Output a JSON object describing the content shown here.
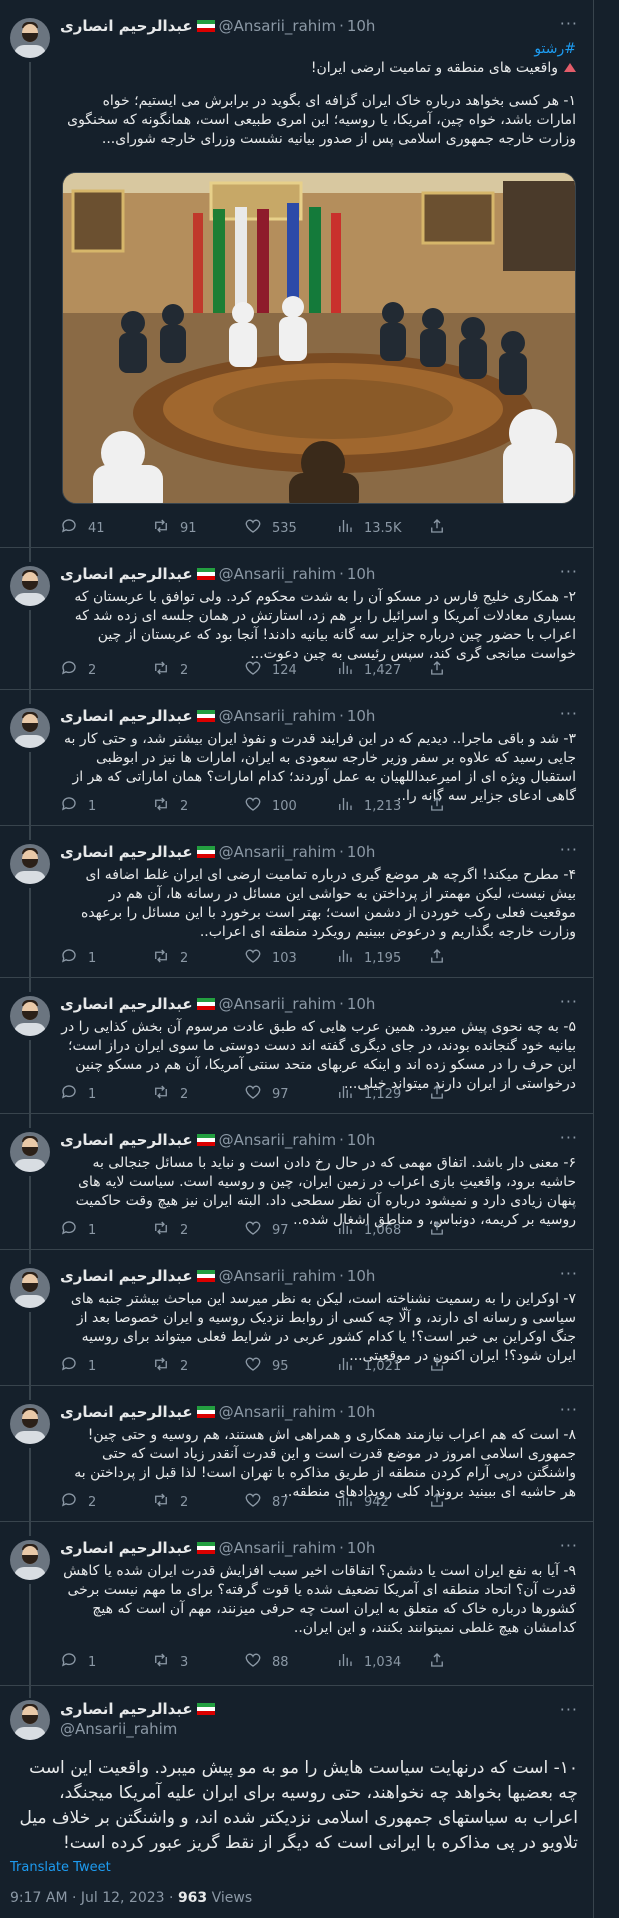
{
  "user": {
    "name": "عبدالرحیم انصاری",
    "handle": "@Ansarii_rahim",
    "flag": "iran-flag",
    "time": "10h"
  },
  "more_label": "···",
  "tweets": [
    {
      "hashtag": "#رشتو",
      "lead": "واقعیت های منطقه و تمامیت ارضی ایران!",
      "text": "۱- هر کسی بخواهد درباره خاک ایران گزافه ای بگوید در برابرش می ایستیم؛ خواه امارات باشد، خواه چین، آمریکا، یا روسیه؛ این امری طبیعی است، همانگونه که سخنگوی وزارت خارجه جمهوری اسلامی پس از صدور بیانیه نشست وزرای خارجه شورای...",
      "image_alt": "meeting-photo",
      "stats": {
        "reply": "41",
        "retweet": "91",
        "like": "535",
        "views": "13.5K"
      }
    },
    {
      "text": "۲- همکاری خلیج فارس در مسکو آن را به شدت محکوم کرد. ولی توافق با عربستان که بسیاری معادلات آمریکا و اسرائیل را بر هم زد، استارتش در همان جلسه ای زده شد که اعراب با حضور چین درباره جزایر سه گانه بیانیه دادند! آنجا بود که عربستان از چین خواست میانجی گری کند، سپس رئیسی به چین دعوت...",
      "stats": {
        "reply": "2",
        "retweet": "2",
        "like": "124",
        "views": "1,427"
      }
    },
    {
      "text": "۳- شد و باقی ماجرا.. دیدیم که در این فرایند قدرت و نفوذ ایران بیشتر شد، و حتی کار به جایی رسید که علاوه بر سفر وزیر خارجه سعودی به ایران، امارات ها نیز در ابوظبی استقبال ویژه ای از امیرعبداللهیان به عمل آوردند؛ کدام امارات؟ همان اماراتی که هر از گاهی ادعای جزایر سه گانه را..",
      "stats": {
        "reply": "1",
        "retweet": "2",
        "like": "100",
        "views": "1,213"
      }
    },
    {
      "text": "۴- مطرح میکند! اگرچه هر موضع گیری درباره تمامیت ارضی ای ایران غلط اضافه ای بیش نیست، لیکن مهمتر از پرداختن به حواشی این مسائل در رسانه ها، آن هم در موقعیت فعلی رکب خوردن از دشمن است؛ بهتر است برخورد با این مسائل را برعهده وزارت خارجه بگذاریم و درعوض ببینیم رویکرد منطقه ای اعراب..",
      "stats": {
        "reply": "1",
        "retweet": "2",
        "like": "103",
        "views": "1,195"
      }
    },
    {
      "text": "۵- به چه نحوی پیش میرود. همین عرب هایی که طبق عادت مرسوم آن بخش کذایی را در بیانیه خود گنجانده بودند، در جای دیگری گفته اند دست دوستی ما سوی ایران دراز است؛ این حرف را در مسکو زده اند و اینکه عربهای متحد سنتی آمریکا، آن هم در مسکو چنین درخواستی از ایران دارند میتواند خیلی...",
      "stats": {
        "reply": "1",
        "retweet": "2",
        "like": "97",
        "views": "1,129"
      }
    },
    {
      "text": "۶- معنی دار باشد. اتفاق مهمی که در حال رخ دادن است و نباید با مسائل جنجالی به حاشیه برود، واقعیتِ بازی اعراب در زمین ایران، چین و روسیه است. سیاست لایه های پنهان زیادی دارد و نمیشود درباره آن نظر سطحی داد. البته ایران نیز هیچ وقت حاکمیت روسیه بر کریمه، دونباس، و مناطق اشغال شده..",
      "stats": {
        "reply": "1",
        "retweet": "2",
        "like": "97",
        "views": "1,068"
      }
    },
    {
      "text": "۷- اوکراین را به رسمیت نشناخته است، لیکن به نظر میرسد این مباحث بیشتر جنبه های سیاسی و رسانه ای دارند، و آلّا چه کسی از روابط نزدیک روسیه و ایران خصوصا بعد از جنگ اوکراین بی خبر است؟! یا کدام کشور عربی در شرایط فعلی میتواند برای روسیه ایران شود؟! ایران اکنون در موقعیتی...",
      "stats": {
        "reply": "1",
        "retweet": "2",
        "like": "95",
        "views": "1,021"
      }
    },
    {
      "text": "۸- است که هم اعراب نیازمند همکاری و همراهی اش هستند، هم روسیه و حتی چین! جمهوری اسلامی امروز در موضع قدرت است و این قدرت آنقدر زیاد است که حتی واشنگتن درپی آرام کردن منطقه از طریق مذاکره با تهران است! لذا قبل از پرداختن به هر حاشیه ای ببینید برونداد کلی رویدادهای منطقه..",
      "stats": {
        "reply": "2",
        "retweet": "2",
        "like": "87",
        "views": "942"
      }
    },
    {
      "text": "۹- آیا به نفع ایران است یا دشمن؟ اتفاقات اخیر سبب افزایش قدرت ایران شده یا کاهش قدرت آن؟ اتحاد منطقه ای آمریکا تضعیف شده یا قوت گرفته؟ برای ما مهم نیست برخی کشورها درباره خاک که متعلق به ایران است چه حرفی میزنند، مهم آن است که هیچ کدامشان هیچ غلطی نمیتوانند بکنند، و این ایران..",
      "stats": {
        "reply": "1",
        "retweet": "3",
        "like": "88",
        "views": "1,034"
      }
    }
  ],
  "main_tweet": {
    "text": "۱۰- است که درنهایت سیاست هایش را مو به مو پیش میبرد. واقعیت این است چه بعضیها بخواهد چه نخواهند، حتی روسیه برای ایران علیه آمریکا میجنگد، اعراب به سیاستهای جمهوری اسلامی نزدیکتر شده اند، و واشنگتن بر خلاف میل تلاویو در پی مذاکره با ایرانی است که دیگر از نقط گریز عبور کرده است!",
    "translate": "Translate Tweet",
    "time": "9:17 AM · Jul 12, 2023 · ",
    "views_count": "963",
    "views_label": " Views"
  }
}
